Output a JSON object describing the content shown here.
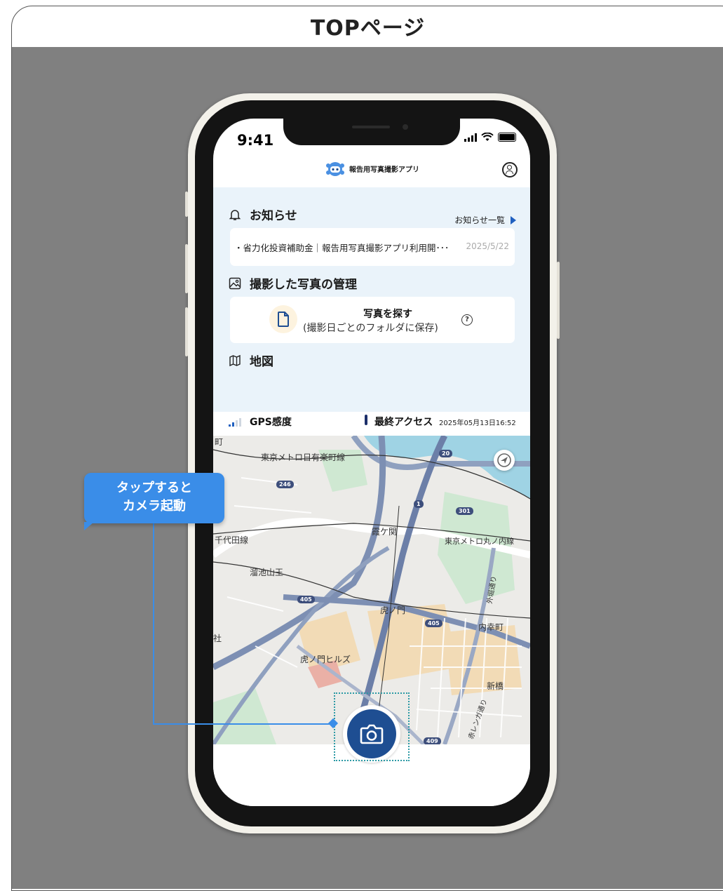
{
  "page": {
    "title": "TOPページ"
  },
  "status_bar": {
    "time": "9:41"
  },
  "app": {
    "title": "報告用写真撮影アプリ"
  },
  "notice": {
    "heading": "お知らせ",
    "list_link": "お知らせ一覧",
    "item_text": "・省力化投資補助金｜報告用写真撮影アプリ利用開･･･",
    "item_date": "2025/5/22"
  },
  "photos": {
    "heading": "撮影した写真の管理",
    "search_title": "写真を探す",
    "search_sub": "(撮影日ごとのフォルダに保存)",
    "help_icon_text": "?"
  },
  "map_section": {
    "heading": "地図"
  },
  "gps": {
    "label": "GPS感度"
  },
  "access": {
    "label": "最終アクセス",
    "timestamp": "2025年05月13日16:52"
  },
  "map": {
    "labels": [
      "東京メトロ日有楽町線",
      "霞ケ関",
      "東京メトロ丸ノ内線",
      "千代田線",
      "溜池山王",
      "虎ノ門",
      "内幸町",
      "虎ノ門ヒルズ",
      "新橋",
      "赤レンガ通り",
      "外堀通り",
      "町",
      "社"
    ],
    "route_badges": [
      "246",
      "20",
      "301",
      "1",
      "405",
      "405",
      "409"
    ]
  },
  "callout": {
    "line1": "タップすると",
    "line2": "カメラ起動"
  },
  "colors": {
    "accent": "#1e4e92",
    "callout": "#3a8de8",
    "panel_bg": "#eaf3fa",
    "background": "#808080"
  }
}
